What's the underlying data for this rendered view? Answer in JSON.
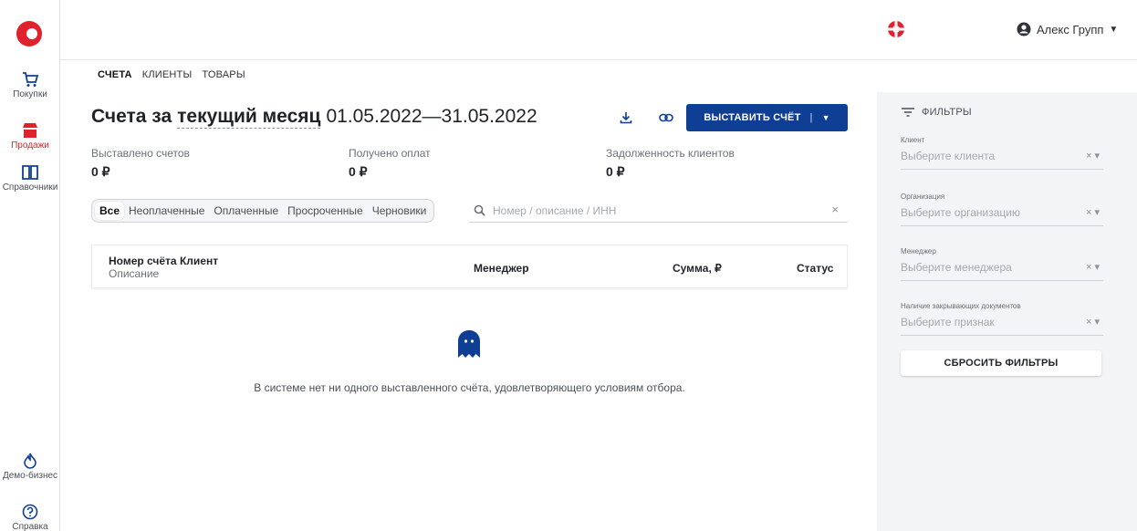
{
  "sidebar": {
    "items": [
      {
        "label": "Покупки",
        "icon": "cart-icon"
      },
      {
        "label": "Продажи",
        "icon": "store-icon"
      },
      {
        "label": "Справочники",
        "icon": "book-icon"
      },
      {
        "label": "Демо-бизнес",
        "icon": "flame-icon"
      },
      {
        "label": "Справка",
        "icon": "help-icon"
      }
    ]
  },
  "header": {
    "user_name": "Алекс Групп"
  },
  "tabs": [
    {
      "label": "СЧЕТА"
    },
    {
      "label": "КЛИЕНТЫ"
    },
    {
      "label": "ТОВАРЫ"
    }
  ],
  "title": {
    "prefix": "Счета за",
    "period_name": "текущий месяц",
    "period_range": "01.05.2022—31.05.2022"
  },
  "actions": {
    "issue_label": "ВЫСТАВИТЬ СЧЁТ",
    "separator": "|"
  },
  "stats": [
    {
      "label": "Выставлено счетов",
      "value": "0 ₽"
    },
    {
      "label": "Получено оплат",
      "value": "0 ₽"
    },
    {
      "label": "Задолженность клиентов",
      "value": "0 ₽"
    }
  ],
  "segments": [
    {
      "label": "Все"
    },
    {
      "label": "Неоплаченные"
    },
    {
      "label": "Оплаченные"
    },
    {
      "label": "Просроченные"
    },
    {
      "label": "Черновики"
    }
  ],
  "search": {
    "placeholder": "Номер / описание / ИНН",
    "clear": "×"
  },
  "table": {
    "columns": {
      "number_client": "Номер счёта Клиент",
      "description": "Описание",
      "manager": "Менеджер",
      "sum": "Сумма, ₽",
      "status": "Статус"
    }
  },
  "empty": {
    "message": "В системе нет ни одного выставленного счёта, удовлетворяющего условиям отбора."
  },
  "filters": {
    "title": "ФИЛЬТРЫ",
    "fields": [
      {
        "label": "Клиент",
        "placeholder": "Выберите клиента"
      },
      {
        "label": "Организация",
        "placeholder": "Выберите организацию"
      },
      {
        "label": "Менеджер",
        "placeholder": "Выберите менеджера"
      },
      {
        "label": "Наличие закрывающих документов",
        "placeholder": "Выберите признак"
      }
    ],
    "controls": "×  ▾",
    "reset_label": "СБРОСИТЬ ФИЛЬТРЫ"
  },
  "colors": {
    "brand_blue": "#0e3f94",
    "brand_red": "#e0212e",
    "panel_bg": "#f3f4f5"
  }
}
